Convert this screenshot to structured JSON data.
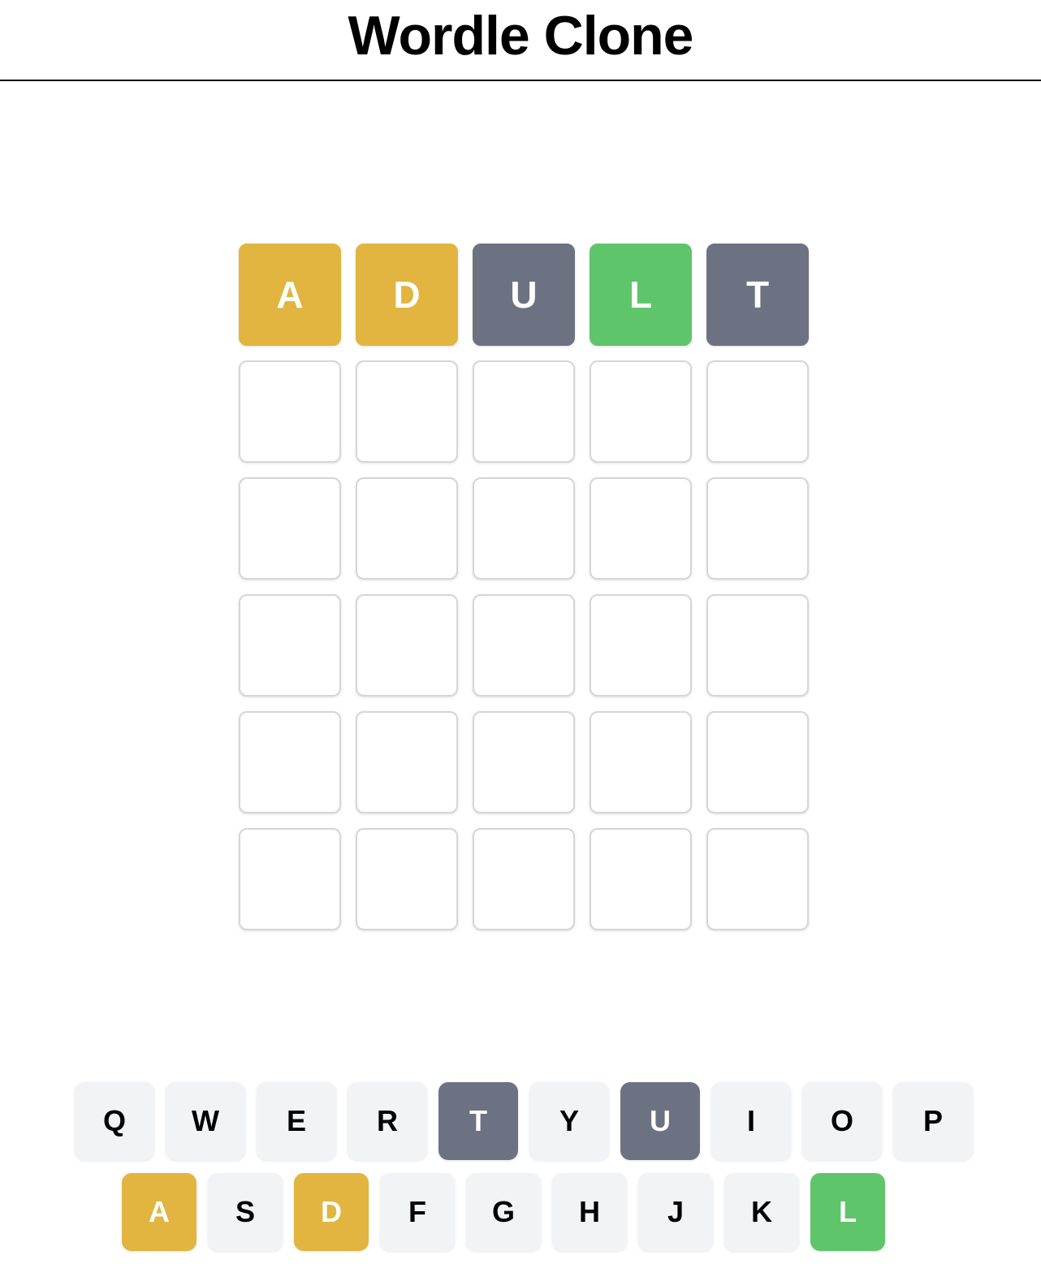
{
  "header": {
    "title": "Wordle Clone"
  },
  "colors": {
    "present": "#e1b53f",
    "absent": "#6d7283",
    "correct": "#5fc56a",
    "key_default": "#f2f3f5",
    "tile_border": "#d6d6d6"
  },
  "board": {
    "rows": [
      [
        {
          "letter": "A",
          "state": "present"
        },
        {
          "letter": "D",
          "state": "present"
        },
        {
          "letter": "U",
          "state": "absent"
        },
        {
          "letter": "L",
          "state": "correct"
        },
        {
          "letter": "T",
          "state": "absent"
        }
      ],
      [
        {
          "letter": "",
          "state": "empty"
        },
        {
          "letter": "",
          "state": "empty"
        },
        {
          "letter": "",
          "state": "empty"
        },
        {
          "letter": "",
          "state": "empty"
        },
        {
          "letter": "",
          "state": "empty"
        }
      ],
      [
        {
          "letter": "",
          "state": "empty"
        },
        {
          "letter": "",
          "state": "empty"
        },
        {
          "letter": "",
          "state": "empty"
        },
        {
          "letter": "",
          "state": "empty"
        },
        {
          "letter": "",
          "state": "empty"
        }
      ],
      [
        {
          "letter": "",
          "state": "empty"
        },
        {
          "letter": "",
          "state": "empty"
        },
        {
          "letter": "",
          "state": "empty"
        },
        {
          "letter": "",
          "state": "empty"
        },
        {
          "letter": "",
          "state": "empty"
        }
      ],
      [
        {
          "letter": "",
          "state": "empty"
        },
        {
          "letter": "",
          "state": "empty"
        },
        {
          "letter": "",
          "state": "empty"
        },
        {
          "letter": "",
          "state": "empty"
        },
        {
          "letter": "",
          "state": "empty"
        }
      ],
      [
        {
          "letter": "",
          "state": "empty"
        },
        {
          "letter": "",
          "state": "empty"
        },
        {
          "letter": "",
          "state": "empty"
        },
        {
          "letter": "",
          "state": "empty"
        },
        {
          "letter": "",
          "state": "empty"
        }
      ]
    ]
  },
  "keyboard": {
    "row1": [
      {
        "label": "Q",
        "state": "default"
      },
      {
        "label": "W",
        "state": "default"
      },
      {
        "label": "E",
        "state": "default"
      },
      {
        "label": "R",
        "state": "default"
      },
      {
        "label": "T",
        "state": "absent"
      },
      {
        "label": "Y",
        "state": "default"
      },
      {
        "label": "U",
        "state": "absent"
      },
      {
        "label": "I",
        "state": "default"
      },
      {
        "label": "O",
        "state": "default"
      },
      {
        "label": "P",
        "state": "default"
      }
    ],
    "row2": [
      {
        "label": "A",
        "state": "present"
      },
      {
        "label": "S",
        "state": "default"
      },
      {
        "label": "D",
        "state": "present"
      },
      {
        "label": "F",
        "state": "default"
      },
      {
        "label": "G",
        "state": "default"
      },
      {
        "label": "H",
        "state": "default"
      },
      {
        "label": "J",
        "state": "default"
      },
      {
        "label": "K",
        "state": "default"
      },
      {
        "label": "L",
        "state": "correct"
      }
    ]
  }
}
